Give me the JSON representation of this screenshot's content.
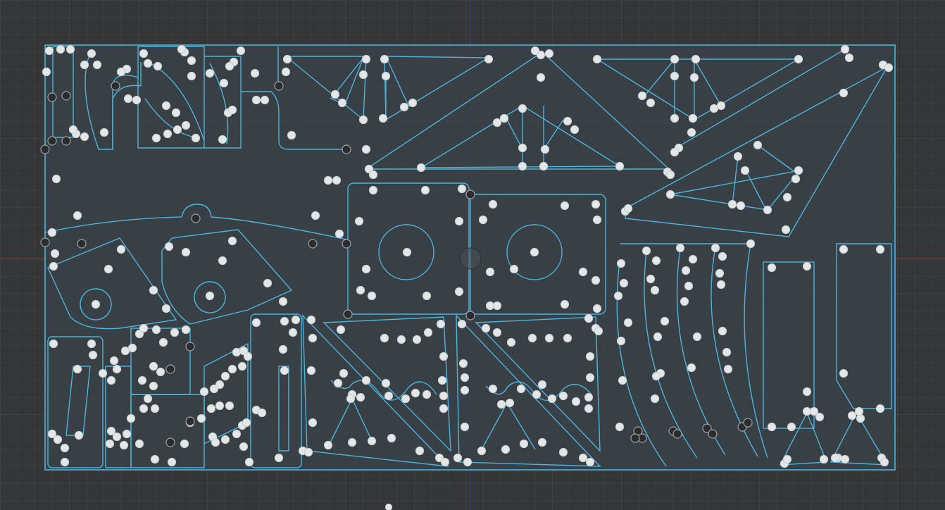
{
  "app": {
    "view": "nest-layout-canvas"
  },
  "colors": {
    "background": "#353637",
    "grid": "#4a4b4c",
    "sheet_fill": "#3a4248",
    "part_outline": "#4cb3dc",
    "hole_fill": "#e4e7e8",
    "hole_stroke": "#c9ccce",
    "dark_point": "#2a2c2e",
    "axis_x": "#7a3434",
    "axis_y": "#3d3d7a"
  },
  "icons": {
    "part_point": "circle-node-icon",
    "origin": "origin-marker-icon"
  }
}
